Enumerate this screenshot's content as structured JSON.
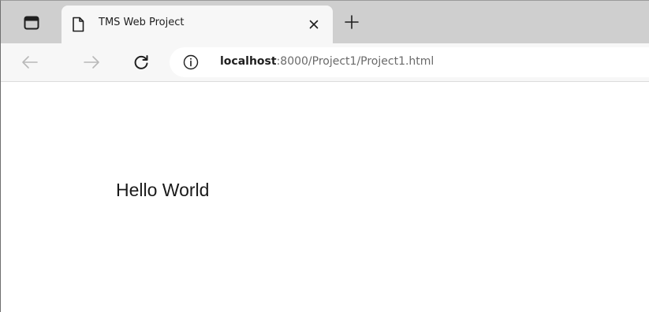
{
  "browser": {
    "tab": {
      "title": "TMS Web Project",
      "page_icon": "page-icon",
      "close_icon": "close-icon"
    },
    "tab_actions_icon": "tab-actions-icon",
    "new_tab_icon": "plus-icon",
    "toolbar": {
      "back_icon": "arrow-left-icon",
      "forward_icon": "arrow-right-icon",
      "refresh_icon": "refresh-icon",
      "info_icon": "info-icon"
    },
    "address": {
      "host": "localhost",
      "rest": ":8000/Project1/Project1.html"
    }
  },
  "page": {
    "text": "Hello World"
  },
  "colors": {
    "tabstrip": "#cfcfcf",
    "toolbar": "#f7f7f7",
    "page_background": "#ffffff"
  }
}
